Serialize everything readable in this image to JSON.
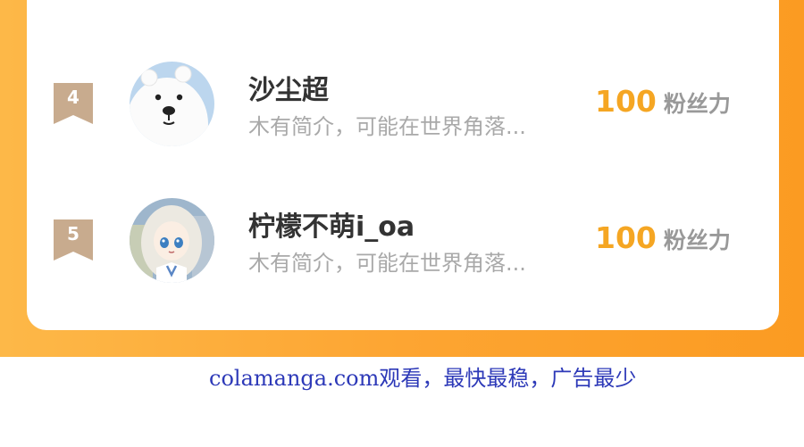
{
  "ranking": {
    "users": [
      {
        "rank": "4",
        "name": "沙尘超",
        "bio": "木有简介，可能在世界角落...",
        "score": "100",
        "score_unit": "粉丝力",
        "avatar_icon": "polar-bear-avatar"
      },
      {
        "rank": "5",
        "name": "柠檬不萌i_oa",
        "bio": "木有简介，可能在世界角落...",
        "score": "100",
        "score_unit": "粉丝力",
        "avatar_icon": "anime-girl-avatar"
      }
    ]
  },
  "footer": {
    "watermark": "colamanga.com观看，最快最稳，广告最少"
  },
  "colors": {
    "panel_orange": "#fda532",
    "score_gold": "#f5a623",
    "badge_tan": "#c8ab8e",
    "watermark_blue": "#2d39b8"
  }
}
